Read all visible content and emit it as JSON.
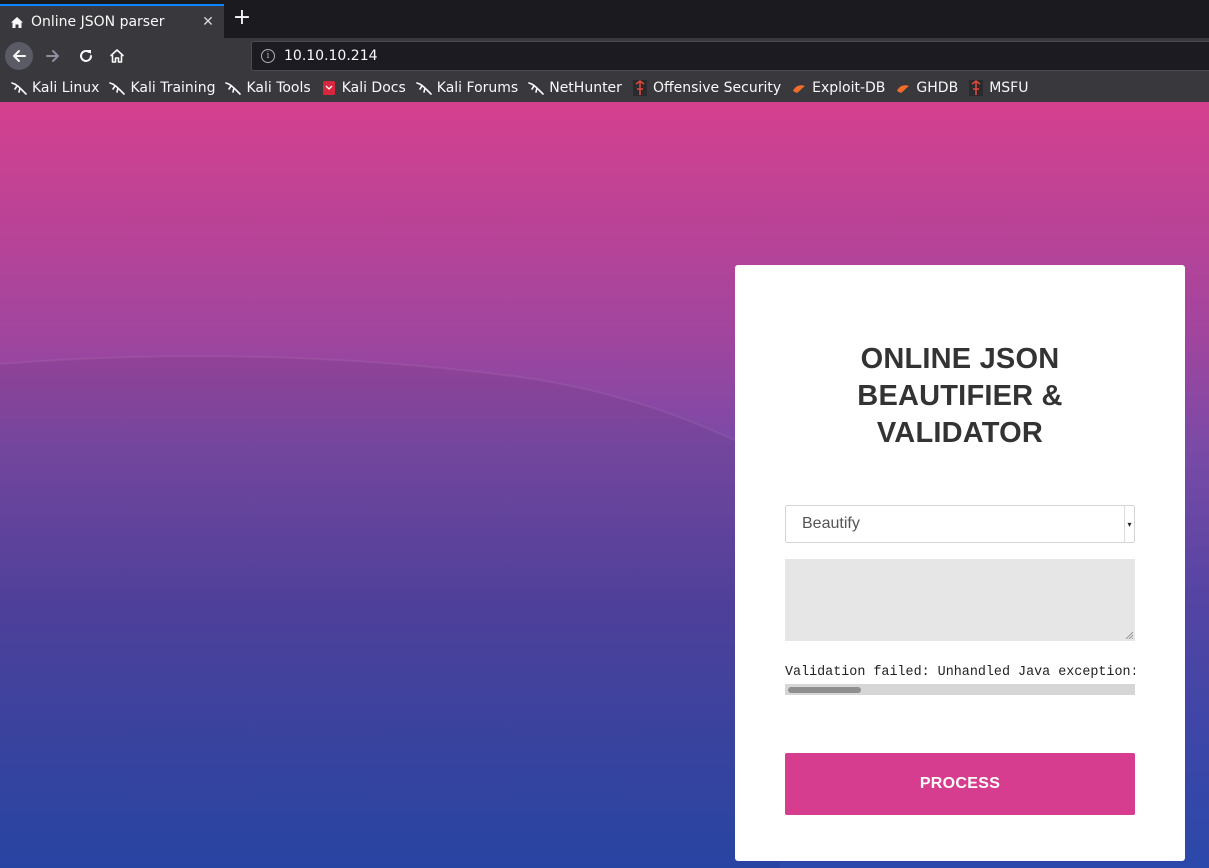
{
  "browser": {
    "tab": {
      "title": "Online JSON parser",
      "close_glyph": "✕",
      "favicon": "home-icon"
    },
    "new_tab_glyph": "+",
    "nav": {
      "back_icon": "arrow-left-icon",
      "forward_icon": "arrow-right-icon",
      "reload_icon": "reload-icon",
      "home_icon": "home-icon"
    },
    "url": "10.10.10.214",
    "url_info_glyph": "i",
    "bookmarks": [
      {
        "label": "Kali Linux",
        "icon": "kali-dragon-icon"
      },
      {
        "label": "Kali Training",
        "icon": "kali-dragon-icon"
      },
      {
        "label": "Kali Tools",
        "icon": "kali-dragon-icon"
      },
      {
        "label": "Kali Docs",
        "icon": "kali-docs-icon"
      },
      {
        "label": "Kali Forums",
        "icon": "kali-dragon-icon"
      },
      {
        "label": "NetHunter",
        "icon": "kali-dragon-icon"
      },
      {
        "label": "Offensive Security",
        "icon": "offsec-icon"
      },
      {
        "label": "Exploit-DB",
        "icon": "exploit-db-icon"
      },
      {
        "label": "GHDB",
        "icon": "exploit-db-icon"
      },
      {
        "label": "MSFU",
        "icon": "offsec-icon"
      }
    ]
  },
  "page": {
    "heading_lines": [
      "ONLINE JSON",
      "BEAUTIFIER &",
      "VALIDATOR"
    ],
    "mode_select": {
      "selected": "Beautify"
    },
    "json_input": {
      "value": ""
    },
    "output_text": "Validation failed: Unhandled Java exception: com.fasterxml.jackson.core.JsonParseException",
    "process_label": "PROCESS",
    "colors": {
      "accent": "#d63d8e",
      "gradient_top": "#d5408e",
      "gradient_bottom": "#2b48ab"
    }
  }
}
